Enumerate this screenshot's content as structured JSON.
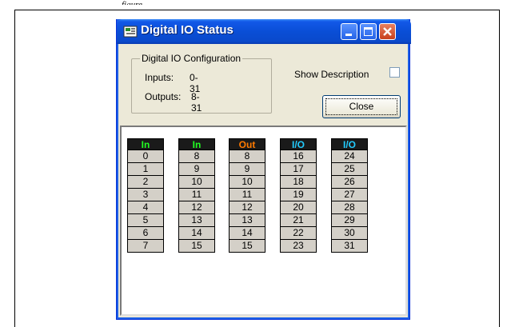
{
  "document": {
    "figure_label": "figure"
  },
  "window": {
    "title": "Digital IO Status",
    "colors": {
      "titlebar": "#0a4ed6",
      "face": "#ece9d8",
      "close_button": "#c8401c"
    }
  },
  "config": {
    "group_title": "Digital IO Configuration",
    "inputs_label": "Inputs:",
    "inputs_value": "0-31",
    "outputs_label": "Outputs:",
    "outputs_value": "8-31"
  },
  "show_description": {
    "label": "Show Description",
    "checked": false
  },
  "close_button": {
    "label": "Close"
  },
  "columns": [
    {
      "header": "In",
      "header_color": "#22ff22",
      "values": [
        "0",
        "1",
        "2",
        "3",
        "4",
        "5",
        "6",
        "7"
      ]
    },
    {
      "header": "In",
      "header_color": "#22ff22",
      "values": [
        "8",
        "9",
        "10",
        "11",
        "12",
        "13",
        "14",
        "15"
      ]
    },
    {
      "header": "Out",
      "header_color": "#ff7a00",
      "values": [
        "8",
        "9",
        "10",
        "11",
        "12",
        "13",
        "14",
        "15"
      ]
    },
    {
      "header": "I/O",
      "header_color": "#22ccff",
      "values": [
        "16",
        "17",
        "18",
        "19",
        "20",
        "21",
        "22",
        "23"
      ]
    },
    {
      "header": "I/O",
      "header_color": "#22ccff",
      "values": [
        "24",
        "25",
        "26",
        "27",
        "28",
        "29",
        "30",
        "31"
      ]
    }
  ]
}
